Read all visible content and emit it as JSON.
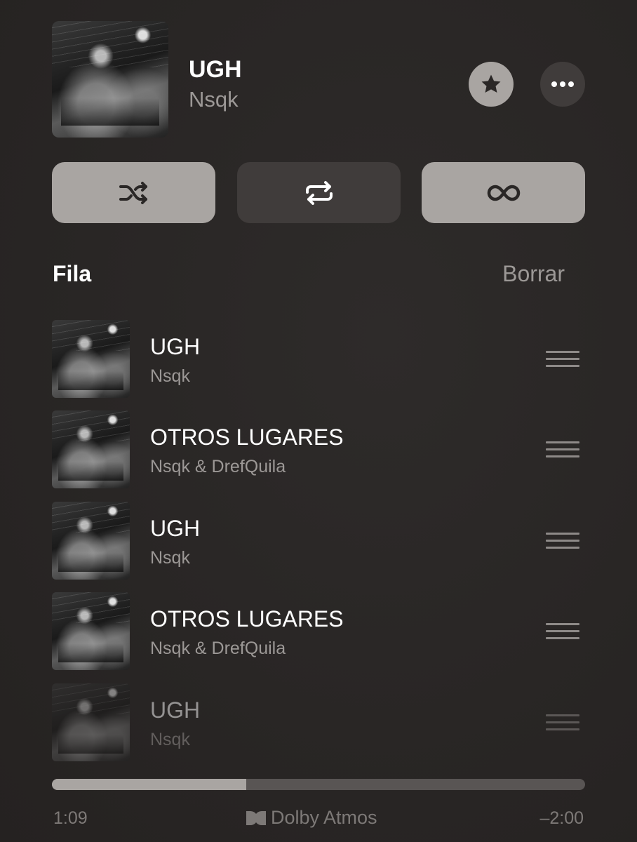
{
  "now_playing": {
    "title": "UGH",
    "artist": "Nsqk",
    "artwork": "album-cover-art"
  },
  "actions": {
    "favorite_icon": "star-icon",
    "more_icon": "ellipsis-icon"
  },
  "controls": [
    {
      "name": "shuffle",
      "icon": "shuffle-icon",
      "active": true
    },
    {
      "name": "repeat",
      "icon": "repeat-icon",
      "active": false
    },
    {
      "name": "autoplay",
      "icon": "infinity-icon",
      "active": true
    }
  ],
  "queue": {
    "title": "Fila",
    "clear_label": "Borrar",
    "items": [
      {
        "title": "UGH",
        "artist": "Nsqk"
      },
      {
        "title": "OTROS LUGARES",
        "artist": "Nsqk & DrefQuila"
      },
      {
        "title": "UGH",
        "artist": "Nsqk"
      },
      {
        "title": "OTROS LUGARES",
        "artist": "Nsqk & DrefQuila"
      },
      {
        "title": "UGH",
        "artist": "Nsqk"
      }
    ]
  },
  "playback": {
    "elapsed": "1:09",
    "remaining": "–2:00",
    "progress_fraction": 0.365,
    "format_label": "Dolby Atmos",
    "format_icon": "dolby-icon"
  },
  "colors": {
    "active_button": "#a9a5a2",
    "inactive_button": "#403c3b",
    "secondary_text": "#9c9896"
  }
}
